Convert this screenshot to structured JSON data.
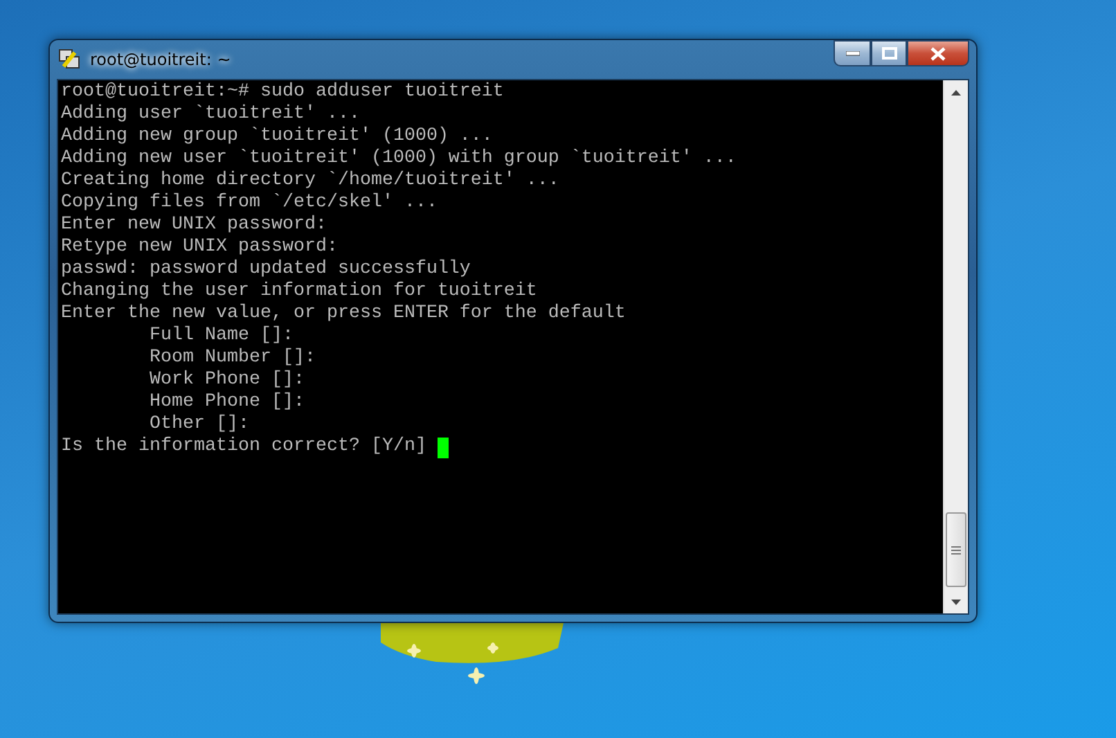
{
  "window": {
    "title": "root@tuoitreit: ~"
  },
  "terminal": {
    "lines": [
      {
        "kind": "output",
        "text": "root@tuoitreit:~# sudo adduser tuoitreit"
      },
      {
        "kind": "output",
        "text": "Adding user `tuoitreit' ..."
      },
      {
        "kind": "output",
        "text": "Adding new group `tuoitreit' (1000) ..."
      },
      {
        "kind": "output",
        "text": "Adding new user `tuoitreit' (1000) with group `tuoitreit' ..."
      },
      {
        "kind": "output",
        "text": "Creating home directory `/home/tuoitreit' ..."
      },
      {
        "kind": "output",
        "text": "Copying files from `/etc/skel' ..."
      },
      {
        "kind": "output",
        "text": "Enter new UNIX password:"
      },
      {
        "kind": "output",
        "text": "Retype new UNIX password:"
      },
      {
        "kind": "output",
        "text": "passwd: password updated successfully"
      },
      {
        "kind": "output",
        "text": "Changing the user information for tuoitreit"
      },
      {
        "kind": "output",
        "text": "Enter the new value, or press ENTER for the default"
      },
      {
        "kind": "field",
        "text": "Full Name []:"
      },
      {
        "kind": "field",
        "text": "Room Number []:"
      },
      {
        "kind": "field",
        "text": "Work Phone []:"
      },
      {
        "kind": "field",
        "text": "Home Phone []:"
      },
      {
        "kind": "field",
        "text": "Other []:"
      },
      {
        "kind": "prompt",
        "text": "Is the information correct? [Y/n]"
      }
    ]
  }
}
